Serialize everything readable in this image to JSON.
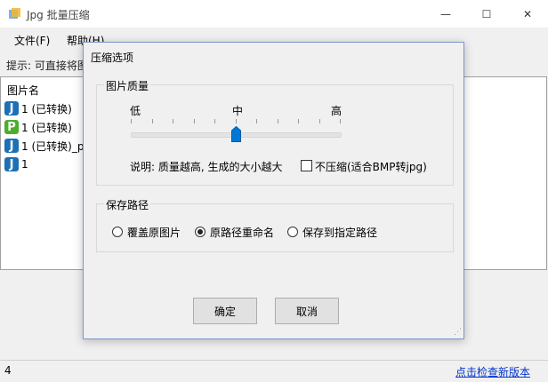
{
  "window": {
    "title": "Jpg 批量压缩",
    "minimize": "—",
    "maximize": "☐",
    "close": "✕"
  },
  "menu": {
    "file": "文件(F)",
    "help": "帮助(H)"
  },
  "hint": "提示: 可直接将图",
  "list": {
    "header": "图片名",
    "items": [
      {
        "icon": "J",
        "name": "1 (已转换)",
        "color": "#1e6fb4"
      },
      {
        "icon": "P",
        "name": "1 (已转换)",
        "color": "#4cae2c"
      },
      {
        "icon": "J",
        "name": "1 (已转换)_p",
        "color": "#1e6fb4"
      },
      {
        "icon": "J",
        "name": "1",
        "color": "#1e6fb4"
      }
    ]
  },
  "status": {
    "count": "4",
    "link": "点击检查新版本"
  },
  "dialog": {
    "title": "压缩选项",
    "quality_group": "图片质量",
    "quality_low": "低",
    "quality_mid": "中",
    "quality_high": "高",
    "quality_level": 0.5,
    "note": "说明: 质量越高, 生成的大小越大",
    "no_compress": "不压缩(适合BMP转jpg)",
    "no_compress_checked": false,
    "path_group": "保存路径",
    "options": [
      "覆盖原图片",
      "原路径重命名",
      "保存到指定路径"
    ],
    "selected_option": 1,
    "ok": "确定",
    "cancel": "取消"
  },
  "colors": {
    "accent": "#0078d7",
    "link": "#0033cc"
  }
}
